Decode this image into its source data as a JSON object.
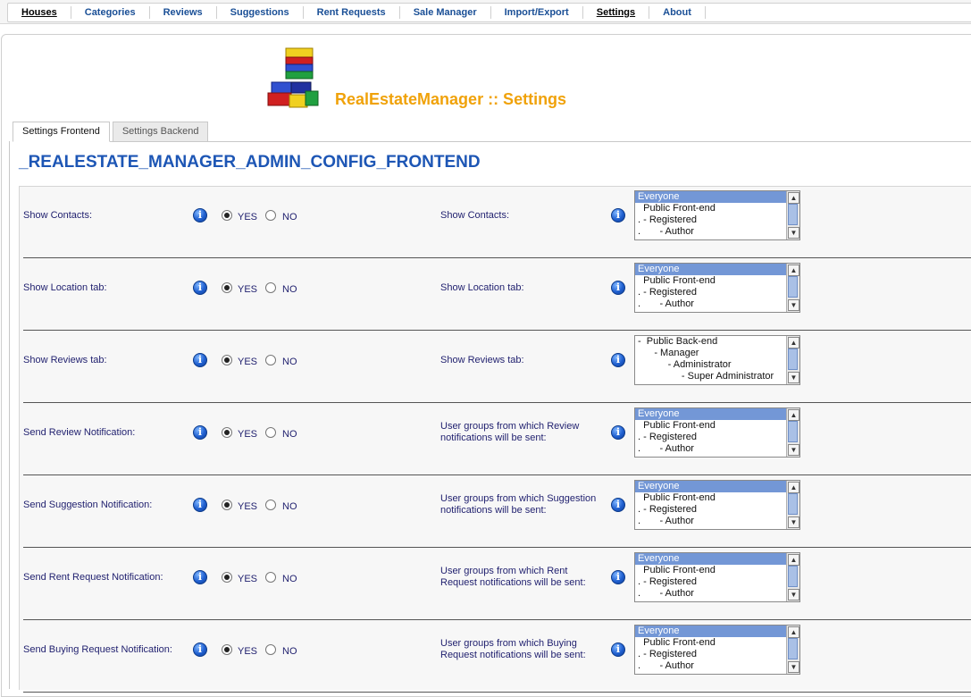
{
  "menu": [
    {
      "label": "Houses",
      "active": true
    },
    {
      "label": "Categories",
      "active": false
    },
    {
      "label": "Reviews",
      "active": false
    },
    {
      "label": "Suggestions",
      "active": false
    },
    {
      "label": "Rent Requests",
      "active": false
    },
    {
      "label": "Sale Manager",
      "active": false
    },
    {
      "label": "Import/Export",
      "active": false
    },
    {
      "label": "Settings",
      "active": true
    },
    {
      "label": "About",
      "active": false
    }
  ],
  "page_title": "RealEstateManager :: Settings",
  "tabs": [
    {
      "label": "Settings Frontend",
      "active": true
    },
    {
      "label": "Settings Backend",
      "active": false
    }
  ],
  "section_title": "_REALESTATE_MANAGER_ADMIN_CONFIG_FRONTEND",
  "radio_labels": {
    "yes": "YES",
    "no": "NO"
  },
  "info_glyph": "i",
  "scroll_glyphs": {
    "up": "▲",
    "down": "▼"
  },
  "rows": [
    {
      "label": "Show Contacts:",
      "value": "YES",
      "right_label": "Show Contacts:",
      "options": [
        "Everyone",
        "  Public Front-end",
        ". - Registered",
        ".       - Author"
      ],
      "selected": 0
    },
    {
      "label": "Show Location tab:",
      "value": "YES",
      "right_label": "Show Location tab:",
      "options": [
        "Everyone",
        "  Public Front-end",
        ". - Registered",
        ".       - Author"
      ],
      "selected": 0
    },
    {
      "label": "Show Reviews tab:",
      "value": "YES",
      "right_label": "Show Reviews tab:",
      "options": [
        "-  Public Back-end",
        "      - Manager",
        "           - Administrator",
        "                - Super Administrator"
      ],
      "selected": -1
    },
    {
      "label": "Send Review Notification:",
      "value": "YES",
      "right_label": "User groups from which Review notifications will be sent:",
      "options": [
        "Everyone",
        "  Public Front-end",
        ". - Registered",
        ".       - Author"
      ],
      "selected": 0
    },
    {
      "label": "Send Suggestion Notification:",
      "value": "YES",
      "right_label": "User groups from which Suggestion notifications will be sent:",
      "options": [
        "Everyone",
        "  Public Front-end",
        ". - Registered",
        ".       - Author"
      ],
      "selected": 0
    },
    {
      "label": "Send Rent Request Notification:",
      "value": "YES",
      "right_label": "User groups from which Rent Request notifications will be sent:",
      "options": [
        "Everyone",
        "  Public Front-end",
        ". - Registered",
        ".       - Author"
      ],
      "selected": 0
    },
    {
      "label": "Send Buying Request Notification:",
      "value": "YES",
      "right_label": "User groups from which Buying Request notifications will be sent:",
      "options": [
        "Everyone",
        "  Public Front-end",
        ". - Registered",
        ".       - Author"
      ],
      "selected": 0
    }
  ]
}
